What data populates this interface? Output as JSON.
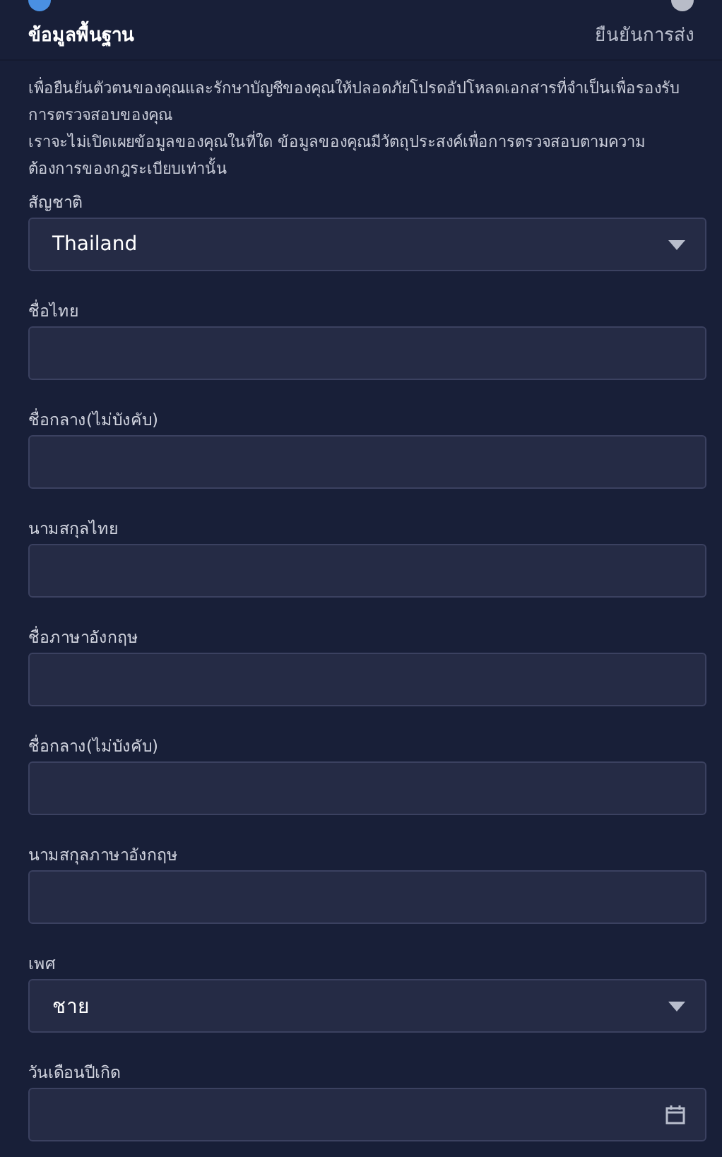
{
  "steps": [
    {
      "label": "ข้อมูลพื้นฐาน",
      "selected": true
    },
    {
      "label": "ยืนยันการส่ง",
      "selected": false
    }
  ],
  "intro": [
    "เพื่อยืนยันตัวตนของคุณและรักษาบัญชีของคุณให้ปลอดภัยโปรดอัปโหลดเอกสารที่จำเป็นเพื่อรองรับการตรวจสอบของคุณ",
    "เราจะไม่เปิดเผยข้อมูลของคุณในที่ใด ข้อมูลของคุณมีวัตถุประสงค์เพื่อการตรวจสอบตามความต้องการของกฎระเบียบเท่านั้น"
  ],
  "fields": [
    {
      "label": "สัญชาติ",
      "kind": "select",
      "value": "Thailand"
    },
    {
      "label": "ชื่อไทย",
      "kind": "text"
    },
    {
      "label": "ชื่อกลาง(ไม่บังคับ)",
      "kind": "text"
    },
    {
      "label": "นามสกุลไทย",
      "kind": "text"
    },
    {
      "label": "ชื่อภาษาอังกฤษ",
      "kind": "text"
    },
    {
      "label": "ชื่อกลาง(ไม่บังคับ)",
      "kind": "text"
    },
    {
      "label": "นามสกุลภาษาอังกฤษ",
      "kind": "text"
    },
    {
      "label": "เพศ",
      "kind": "select",
      "value": "ชาย"
    },
    {
      "label": "วันเดือนปีเกิด",
      "kind": "date"
    }
  ]
}
